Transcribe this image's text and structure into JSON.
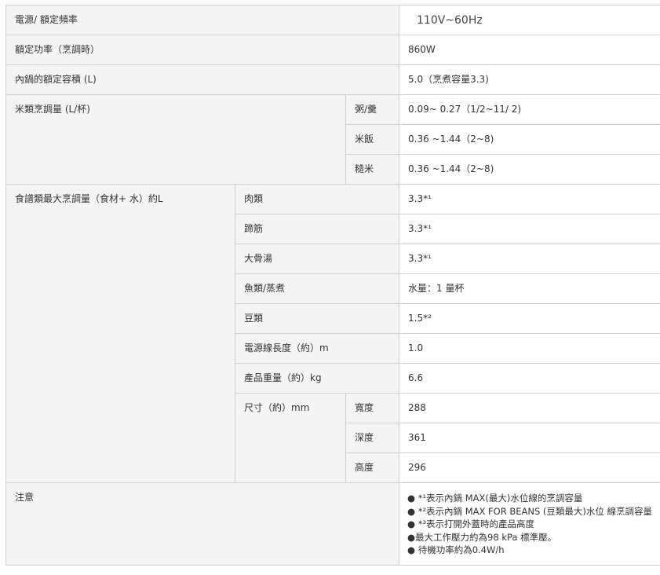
{
  "spec": {
    "power_source": {
      "label": "電源/ 額定頻率",
      "value": "110V~60Hz"
    },
    "rated_power": {
      "label": "額定功率（烹調時）",
      "value": "860W"
    },
    "inner_pot_capacity": {
      "label": "內鍋的額定容積 (L)",
      "value": "5.0（烹煮容量3.3)"
    },
    "rice_capacity": {
      "label": "米類烹調量 (L/杯)",
      "rows": [
        {
          "label": "粥/羹",
          "value": "0.09~ 0.27（1/2~11/ 2)"
        },
        {
          "label": "米飯",
          "value": "0.36 ~1.44（2~8)"
        },
        {
          "label": "糙米",
          "value": "0.36 ~1.44（2~8)"
        }
      ]
    },
    "food_capacity": {
      "label": "食譜類最大烹調量（食材+ 水）約L",
      "rows": [
        {
          "label": "肉類",
          "value": "3.3*¹"
        },
        {
          "label": "蹄筋",
          "value": "3.3*¹"
        },
        {
          "label": "大骨湯",
          "value": "3.3*¹"
        },
        {
          "label": "魚類/蒸煮",
          "value": "水量：1 量杯"
        },
        {
          "label": "豆類",
          "value": "1.5*²"
        }
      ]
    },
    "cord_length": {
      "label": "電源線長度（約）m",
      "value": "1.0"
    },
    "weight": {
      "label": "產品重量（約）kg",
      "value": "6.6"
    },
    "dimensions": {
      "label": "尺寸（約）mm",
      "rows": [
        {
          "label": "寬度",
          "value": "288"
        },
        {
          "label": "深度",
          "value": "361"
        },
        {
          "label": "高度",
          "value": "296"
        }
      ]
    },
    "notes": {
      "label": "注意",
      "items": [
        "● *¹表示內鍋 MAX(最大)水位線的烹調容量",
        "● *²表示內鍋 MAX FOR BEANS (豆類最大)水位 線烹調容量",
        "● *³表示打開外蓋時的產品高度",
        "●最大工作壓力約為98 kPa 標準壓。",
        "● 待機功率約為0.4W/h"
      ]
    }
  }
}
